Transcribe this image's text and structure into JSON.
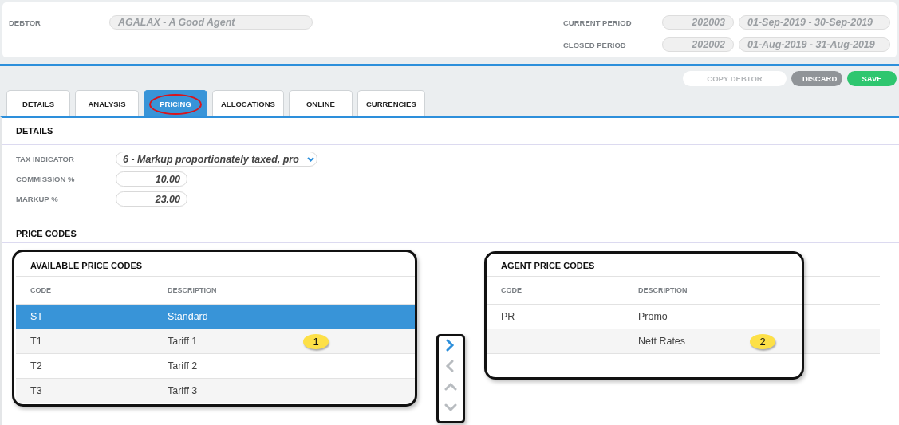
{
  "header": {
    "debtor": {
      "label": "DEBTOR",
      "value": "AGALAX - A Good Agent"
    },
    "periods": [
      {
        "label": "CURRENT PERIOD",
        "period": "202003",
        "range": "01-Sep-2019 - 30-Sep-2019"
      },
      {
        "label": "CLOSED PERIOD",
        "period": "202002",
        "range": "01-Aug-2019 - 31-Aug-2019"
      }
    ]
  },
  "actions": [
    {
      "label": "COPY DEBTOR",
      "kind": "plain"
    },
    {
      "label": "DISCARD",
      "kind": "neutral"
    },
    {
      "label": "SAVE",
      "kind": "primary"
    }
  ],
  "tabs": [
    {
      "label": "DETAILS",
      "selected": false,
      "highlighted": false
    },
    {
      "label": "ANALYSIS",
      "selected": false,
      "highlighted": false
    },
    {
      "label": "PRICING",
      "selected": true,
      "highlighted": true
    },
    {
      "label": "ALLOCATIONS",
      "selected": false,
      "highlighted": false
    },
    {
      "label": "ONLINE",
      "selected": false,
      "highlighted": false
    },
    {
      "label": "CURRENCIES",
      "selected": false,
      "highlighted": false
    }
  ],
  "details": {
    "title": "DETAILS",
    "fields": [
      {
        "label": "TAX INDICATOR",
        "kind": "select",
        "value": "6 - Markup proportionately taxed, pro"
      },
      {
        "label": "COMMISSION %",
        "kind": "number",
        "value": "10.00"
      },
      {
        "label": "MARKUP %",
        "kind": "number",
        "value": "23.00"
      }
    ]
  },
  "price_codes": {
    "title": "PRICE CODES",
    "available": {
      "title": "AVAILABLE PRICE CODES",
      "highlighted": true,
      "columns": [
        "CODE",
        "DESCRIPTION"
      ],
      "rows": [
        {
          "code": "ST",
          "description": "Standard",
          "selected": true
        },
        {
          "code": "T1",
          "description": "Tariff 1",
          "selected": false,
          "callout": "1"
        },
        {
          "code": "T2",
          "description": "Tariff 2",
          "selected": false
        },
        {
          "code": "T3",
          "description": "Tariff 3",
          "selected": false
        }
      ]
    },
    "movers": {
      "highlighted": true,
      "buttons": [
        {
          "kind": "right",
          "disabled": false
        },
        {
          "kind": "left",
          "disabled": true
        },
        {
          "kind": "up",
          "disabled": true
        },
        {
          "kind": "down",
          "disabled": true
        }
      ]
    },
    "agent": {
      "title": "AGENT PRICE CODES",
      "highlighted": true,
      "columns": [
        "CODE",
        "DESCRIPTION"
      ],
      "rows": [
        {
          "code": "PR",
          "description": "Promo",
          "selected": false
        },
        {
          "description": "Nett Rates",
          "selected": false,
          "callout": "2"
        }
      ]
    }
  }
}
